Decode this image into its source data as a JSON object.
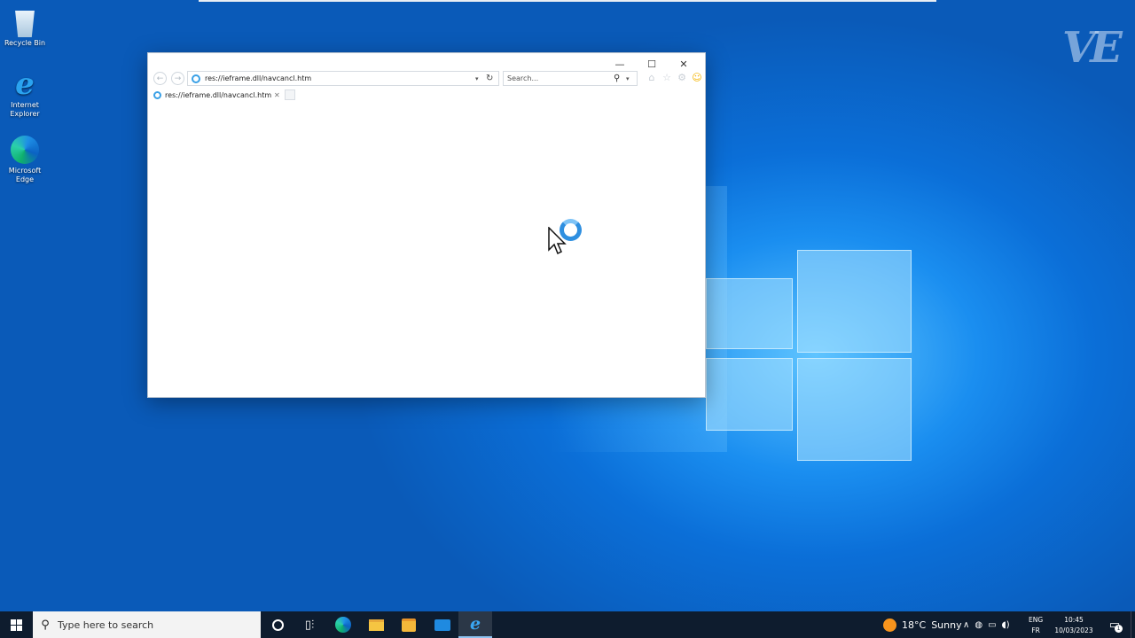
{
  "desktop": {
    "watermark": "VE",
    "icons": [
      {
        "label": "Recycle Bin",
        "icon": "recycle-bin-icon"
      },
      {
        "label": "Internet Explorer",
        "icon": "internet-explorer-icon"
      },
      {
        "label": "Microsoft Edge",
        "icon": "microsoft-edge-icon"
      }
    ]
  },
  "browser": {
    "address_url": "res://ieframe.dll/navcancl.htm",
    "search_placeholder": "Search...",
    "tab_title": "res://ieframe.dll/navcancl.htm",
    "controls": {
      "minimize": "—",
      "maximize": "☐",
      "close": "✕"
    }
  },
  "taskbar": {
    "search_placeholder": "Type here to search",
    "weather_temp": "18°C",
    "weather_desc": "Sunny",
    "lang_top": "ENG",
    "lang_bottom": "FR",
    "time": "10:45",
    "date": "10/03/2023",
    "notification_count": "1",
    "colors": {
      "bar": "#0e1c2e",
      "accent": "#1e8fe6"
    }
  }
}
